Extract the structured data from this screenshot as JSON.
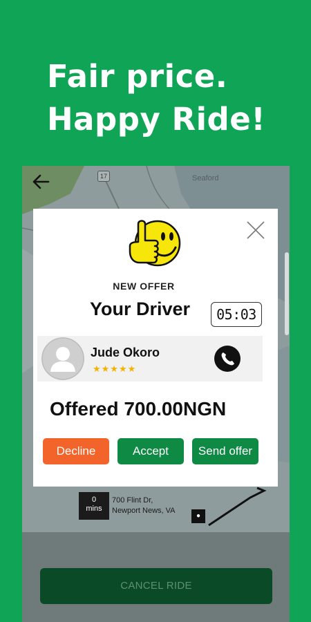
{
  "headline": {
    "line1": "Fair price.",
    "line2": "Happy Ride!"
  },
  "map": {
    "city_label": "Seaford",
    "route_number": "17",
    "eta_value": "0",
    "eta_unit": "mins",
    "destination_line1": "700 Flint Dr,",
    "destination_line2": "Newport News, VA"
  },
  "modal": {
    "new_offer_label": "NEW OFFER",
    "title": "Your Driver",
    "timer": "05:03",
    "driver_name": "Jude Okoro",
    "rating_stars": "★★★★★",
    "rating": 5,
    "offer_text": "Offered 700.00NGN",
    "buttons": {
      "decline": "Decline",
      "accept": "Accept",
      "send_offer": "Send offer"
    }
  },
  "bottom": {
    "cancel_label": "CANCEL RIDE"
  },
  "colors": {
    "brand_green": "#0fa456",
    "button_green": "#0f8a44",
    "decline_orange": "#f2642a",
    "star_gold": "#f2b300"
  },
  "icons": [
    "back-arrow-icon",
    "close-icon",
    "thumbs-up-smiley-icon",
    "avatar-placeholder-icon",
    "phone-icon"
  ]
}
